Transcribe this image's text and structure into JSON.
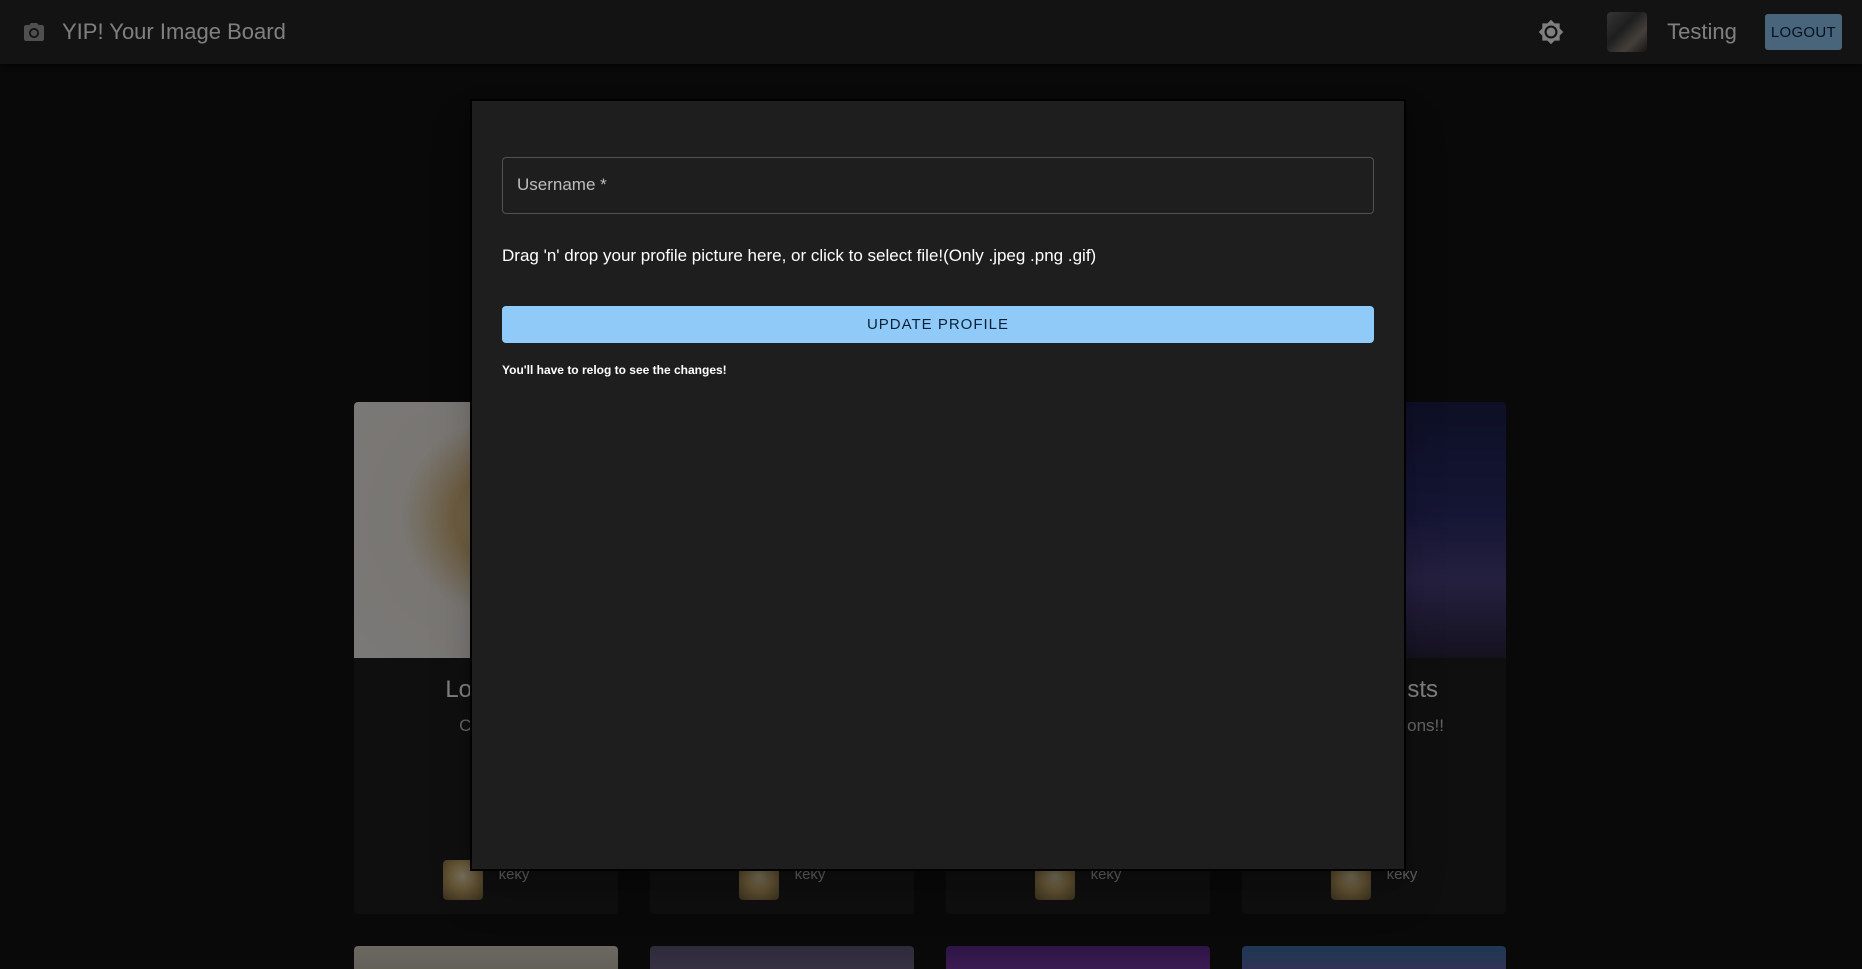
{
  "app": {
    "title": "YIP! Your Image Board",
    "user_name": "Testing",
    "logout_label": "LOGOUT"
  },
  "cards": [
    {
      "title": "Lorem I",
      "description": "Cat Ips",
      "author": "keky"
    },
    {
      "title": "",
      "description": "",
      "author": "keky"
    },
    {
      "title": "",
      "description": "",
      "author": "keky"
    },
    {
      "title": "sts",
      "description": "ons!!",
      "author": "keky"
    }
  ],
  "modal": {
    "username_label": "Username *",
    "username_value": "",
    "dropzone_text": "Drag 'n' drop your profile picture here, or click to select file!(Only .jpeg .png .gif)",
    "update_label": "UPDATE PROFILE",
    "relog_note": "You'll have to relog to see the changes!"
  },
  "colors": {
    "primary": "#90caf9",
    "appbar": "#272727",
    "background": "#121212",
    "surface": "#1e1e1e"
  },
  "icons": {
    "brand": "camera-icon",
    "theme_toggle": "brightness-icon"
  }
}
